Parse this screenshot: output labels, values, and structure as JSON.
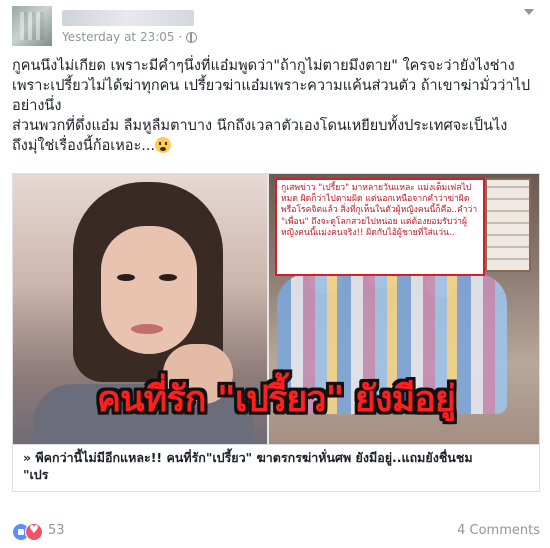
{
  "post": {
    "timestamp": "Yesterday at 23:05",
    "separator": "·",
    "text_lines": [
      "กูคนนึงไม่เกียด เพราะมีคำๆนึ่งที่แอ๋มพูดว่า\"ถ้ากูไม่ตายมึงตาย\" ใครจะว่ายังไงช่าง",
      "เพราะเปรี้ยวไม่ได้ฆ่าทุกคน เปรี้ยวฆ่าแอ๋มเพราะความแค้นส่วนตัว ถ้าเขาฆ่ามั่วว่าไป",
      "อย่างนึ่ง",
      "ส่วนพวกที่ดึ่งแอ๋ม ลืมหูลืมตาบาง นึกถึงเวลาตัวเองโดนเหยียบทั้งประเทศจะเป็นไง",
      "ถึงมุ่ใช่เรื่องนี้ก้อเหอะ..."
    ]
  },
  "preview": {
    "callout_text": "กูเสพข่าว \"เปรี้ยว\" มาหลายวันแหละ แม่งเต็มเฟสไปหมด ผิดก็ว่าไปตามผิด แต่นอกเหนือจากคำว่าฆ่าผิดพรือโรคจิตแล้ว สิ่งที่กูเห็นในตัวผู้หญิงคนนี้ก็คือ..คำว่า \"เพื่อน\" ถึงจะดูโลกสวยไปหน่อย แต่ต้องยอมรับว่าผู้หญิงคนนี้แม่งคนจริง!! ผิดกับไอ้ผู้ชายที่ใส่แว่น..",
    "overlay_title": "คนที่รัก \"เปรี้ยว\" ยังมีอยู่",
    "caption_line1": "» พีคกว่านี้ไม่มีอีกแหละ!! คนที่รัก\"เปรี้ยว\" ฆาตรกรฆ่าหั่นศพ ยังมีอยู่..แถมยังชื่นชม",
    "caption_line2": "\"เปร"
  },
  "footer": {
    "reaction_count": "53",
    "comments": "4 Comments"
  },
  "icons": [
    "globe-icon",
    "menu-chevron-icon",
    "scream-emoji-icon",
    "like-icon",
    "love-icon"
  ],
  "colors": {
    "headline_red": "#ff1f1f",
    "meta_gray": "#90949c",
    "like_blue": "#5890ff",
    "love_red": "#f25268"
  }
}
